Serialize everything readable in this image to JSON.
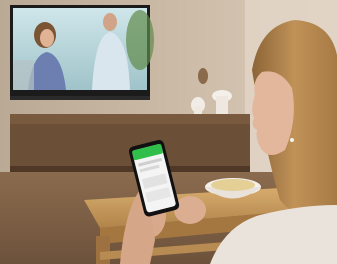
{
  "photo": {
    "colors": {
      "wall": "#c9b9a6",
      "floor": "#8a6a4e",
      "tv_frame": "#1b1b1b",
      "tv_screen_sky": "#b9d7de",
      "sideboard": "#6b4f37",
      "table": "#c79a5b",
      "phone_accent": "#2fbf4a",
      "sweater": "#e9e3db",
      "hair": "#b88b52",
      "skin": "#e3b79c"
    }
  }
}
